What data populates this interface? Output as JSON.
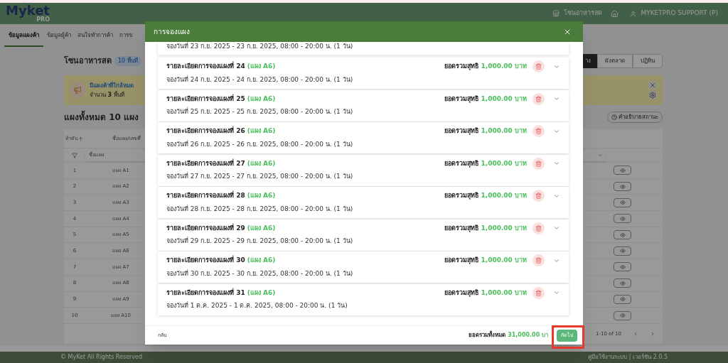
{
  "app_header": {
    "logo": "Myket",
    "logo_sub": "PRO",
    "zone": "โซนอาหารสด",
    "user": "MYKETPRO SUPPORT (P)"
  },
  "nav_tabs": [
    {
      "label": "ข้อมูลแผงค้า",
      "selected": true
    },
    {
      "label": "ข้อมูลผู้ค้า",
      "selected": false
    },
    {
      "label": "สนใจทำการค้า",
      "selected": false
    },
    {
      "label": "การข",
      "selected": false
    }
  ],
  "page": {
    "title": "โซนอาหารสด",
    "badge": "10 พื้นที่",
    "view_buttons": [
      {
        "label": "าง",
        "selected": true
      },
      {
        "label": "ผังตลาด",
        "selected": false
      },
      {
        "label": "ปฏิทิน",
        "selected": false
      }
    ],
    "alert": {
      "title": "มีแผงค้าที่ใกล้หมด",
      "count": "จำนวน **3** พื้นที่"
    },
    "stall_count": "แผงทั้งหมด 10 แผง",
    "legend_button": "คำอธิบายสถานะ"
  },
  "table": {
    "columns": [
      "ลำดับ",
      "ชื่อแผง/เลขที่"
    ],
    "filter_placeholder": "ชื่อแผง",
    "rows": [
      {
        "number": "1",
        "name": "แผง A1"
      },
      {
        "number": "2",
        "name": "แผง A2"
      },
      {
        "number": "3",
        "name": "แผง A3"
      },
      {
        "number": "4",
        "name": "แผง A4"
      },
      {
        "number": "5",
        "name": "แผง A5"
      },
      {
        "number": "6",
        "name": "แผง A6"
      },
      {
        "number": "7",
        "name": "แผง A7"
      },
      {
        "number": "8",
        "name": "แผง A8"
      },
      {
        "number": "9",
        "name": "แผง A9"
      },
      {
        "number": "10",
        "name": "แผง A10"
      }
    ],
    "pagination": "1-10 of 10"
  },
  "footer": {
    "copyright": "© MyKet All Rights Reserved",
    "links": "คู่มือใช้งานระบบ | เวอร์ชัน 2.0.5"
  },
  "dialog": {
    "title": "การจองแผง",
    "partial_booking": "จองวันที่ 23 ก.ย. 2025 - 23 ก.ย. 2025, 08:00 - 20:00 น. (1 วัน)",
    "bookings": [
      {
        "title": "รายละเอียดการจองแผงที่ 24",
        "stall": "(แผง A6)",
        "net_label": "ยอดรวมสุทธิ",
        "net_amount": "1,000.00 บาท",
        "dates": "จองวันที่ 24 ก.ย. 2025 - 24 ก.ย. 2025, 08:00 - 20:00 น. (1 วัน)"
      },
      {
        "title": "รายละเอียดการจองแผงที่ 25",
        "stall": "(แผง A6)",
        "net_label": "ยอดรวมสุทธิ",
        "net_amount": "1,000.00 บาท",
        "dates": "จองวันที่ 25 ก.ย. 2025 - 25 ก.ย. 2025, 08:00 - 20:00 น. (1 วัน)"
      },
      {
        "title": "รายละเอียดการจองแผงที่ 26",
        "stall": "(แผง A6)",
        "net_label": "ยอดรวมสุทธิ",
        "net_amount": "1,000.00 บาท",
        "dates": "จองวันที่ 26 ก.ย. 2025 - 26 ก.ย. 2025, 08:00 - 20:00 น. (1 วัน)"
      },
      {
        "title": "รายละเอียดการจองแผงที่ 27",
        "stall": "(แผง A6)",
        "net_label": "ยอดรวมสุทธิ",
        "net_amount": "1,000.00 บาท",
        "dates": "จองวันที่ 27 ก.ย. 2025 - 27 ก.ย. 2025, 08:00 - 20:00 น. (1 วัน)"
      },
      {
        "title": "รายละเอียดการจองแผงที่ 28",
        "stall": "(แผง A6)",
        "net_label": "ยอดรวมสุทธิ",
        "net_amount": "1,000.00 บาท",
        "dates": "จองวันที่ 28 ก.ย. 2025 - 28 ก.ย. 2025, 08:00 - 20:00 น. (1 วัน)"
      },
      {
        "title": "รายละเอียดการจองแผงที่ 29",
        "stall": "(แผง A6)",
        "net_label": "ยอดรวมสุทธิ",
        "net_amount": "1,000.00 บาท",
        "dates": "จองวันที่ 29 ก.ย. 2025 - 29 ก.ย. 2025, 08:00 - 20:00 น. (1 วัน)"
      },
      {
        "title": "รายละเอียดการจองแผงที่ 30",
        "stall": "(แผง A6)",
        "net_label": "ยอดรวมสุทธิ",
        "net_amount": "1,000.00 บาท",
        "dates": "จองวันที่ 30 ก.ย. 2025 - 30 ก.ย. 2025, 08:00 - 20:00 น. (1 วัน)"
      },
      {
        "title": "รายละเอียดการจองแผงที่ 31",
        "stall": "(แผง A6)",
        "net_label": "ยอดรวมสุทธิ",
        "net_amount": "1,000.00 บาท",
        "dates": "จองวันที่ 1 ต.ค. 2025 - 1 ต.ค. 2025, 08:00 - 20:00 น. (1 วัน)"
      }
    ],
    "back": "กลับ",
    "total_label": "ยอดรวมทั้งหมด",
    "total_amount": "31,000.00 บา",
    "next": "ถัดไป",
    "next_highlighted": true
  }
}
